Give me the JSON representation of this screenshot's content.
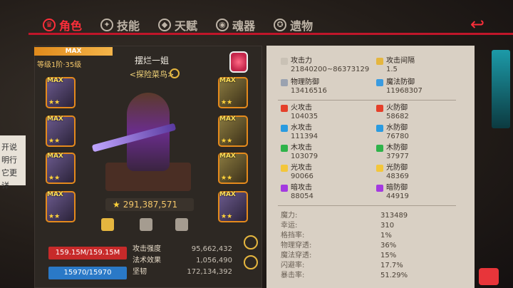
{
  "tabs": [
    {
      "label": "角色",
      "icon": "character-icon",
      "active": true
    },
    {
      "label": "技能",
      "icon": "skill-icon",
      "active": false
    },
    {
      "label": "天赋",
      "icon": "talent-icon",
      "active": false
    },
    {
      "label": "魂器",
      "icon": "soul-icon",
      "active": false
    },
    {
      "label": "遗物",
      "icon": "relic-icon",
      "active": false
    }
  ],
  "side_note": "开说明行\n它更详",
  "hero": {
    "max_label": "MAX",
    "level_text": "等级1阶·35级",
    "name": "摆烂一姐",
    "title": "<探险菜鸟>",
    "power": "291,387,571"
  },
  "equipment_left": [
    {
      "tag": "MAX",
      "stars": "★★"
    },
    {
      "tag": "MAX",
      "stars": "★★"
    },
    {
      "tag": "MAX",
      "stars": "★★"
    },
    {
      "tag": "MAX",
      "stars": "★★"
    }
  ],
  "equipment_right": [
    {
      "tag": "MAX",
      "stars": "★★"
    },
    {
      "tag": "MAX",
      "stars": "★★"
    },
    {
      "tag": "MAX",
      "stars": "★★"
    },
    {
      "tag": "MAX",
      "stars": "★★"
    }
  ],
  "bars": {
    "hp": "159.15M/159.15M",
    "mp": "15970/15970"
  },
  "substats": [
    {
      "label": "攻击强度",
      "value": "95,662,432"
    },
    {
      "label": "法术效果",
      "value": "1,056,490"
    },
    {
      "label": "坚韧",
      "value": "172,134,392"
    }
  ],
  "stats_top": [
    {
      "label": "攻击力",
      "value": "21840200~86373129",
      "color": "#c9c1b5"
    },
    {
      "label": "攻击间隔",
      "value": "1.5",
      "color": "#e5b63f"
    },
    {
      "label": "物理防御",
      "value": "13416516",
      "color": "#9aa2b0"
    },
    {
      "label": "魔法防御",
      "value": "11968307",
      "color": "#3a9be0"
    }
  ],
  "stats_elem": [
    {
      "label": "火攻击",
      "value": "104035",
      "color": "#e5402a"
    },
    {
      "label": "火防御",
      "value": "58682",
      "color": "#e5402a"
    },
    {
      "label": "水攻击",
      "value": "111394",
      "color": "#2a9be0"
    },
    {
      "label": "水防御",
      "value": "76780",
      "color": "#2a9be0"
    },
    {
      "label": "木攻击",
      "value": "103079",
      "color": "#2fb34a"
    },
    {
      "label": "木防御",
      "value": "37977",
      "color": "#2fb34a"
    },
    {
      "label": "光攻击",
      "value": "90066",
      "color": "#f3c63a"
    },
    {
      "label": "光防御",
      "value": "48369",
      "color": "#f3c63a"
    },
    {
      "label": "暗攻击",
      "value": "88054",
      "color": "#a43ae0"
    },
    {
      "label": "暗防御",
      "value": "44919",
      "color": "#a43ae0"
    }
  ],
  "stats_bottom": [
    {
      "label": "魔力:",
      "value": "313489"
    },
    {
      "label": "幸运:",
      "value": "310"
    },
    {
      "label": "格挡率:",
      "value": "1%"
    },
    {
      "label": "物理穿透:",
      "value": "36%"
    },
    {
      "label": "魔法穿透:",
      "value": "15%"
    },
    {
      "label": "闪避率:",
      "value": "17.7%"
    },
    {
      "label": "暴击率:",
      "value": "51.29%"
    }
  ]
}
